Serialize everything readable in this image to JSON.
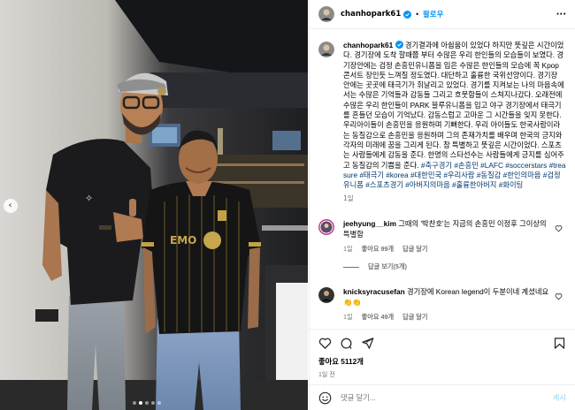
{
  "post": {
    "author": {
      "username": "chanhopark61",
      "avatar_icon": "avatar-photo",
      "verified_icon": "verified-badge-icon"
    },
    "follow_label": "팔로우",
    "separator": "•",
    "more_icon": "more-horizontal-icon",
    "more_label": "···",
    "caption": {
      "username": "chanhopark61",
      "text": "경기결과에 아쉼움이 있었다 하지만 뜻깊은 시간이었다. 경기장에 도착 할때쯤 부터 수많은 우리 한인들의 모습들이 보였다. 경기장안에는 검정 손흥민유니폼을 입은 수많은 한인들의 모습에 꼭 Kpop 콘서트 장인듯 느껴질 정도였다. 대단하고 훌륭한 국위선양이다. 경기장 안에는 곳곳에 태극기가 휘날리고 있었다. 경기를 지켜보는 나의 마음속에서는 수많은 기억들과 감동들 그리고 흐뭇함들이 스쳐지나갔다. 오래전에 수많은 우리 한인들이 PARK 블루유니폼을 입고 야구 경기장에서 태극기를 흔들던 모습이 기억났다. 감동스럽고 고마운 그 시간들을 잊지 못한다. 우리아이들이 손흥민을 응원하며 기뻐한다. 우리 아이들도 한국사람이라는 동질감으로 손흥민을 응원하며 그의 존재가치를 배우며 한국의 긍지와 각자의 미래에 꿈을 그리게 된다. 참 특별하고 뜻깊은 시간이었다. 스포츠는 사람들에게 감동을 준다. 한명의 스타선수는 사람들에게 긍지를 심어주고 동질감의 기쁨을 준다.",
      "hashtags": "#축구경기 #손흥민 #LAFC #soccerstars #treasure #태극기 #korea #대한민국 #우리사람 #동질감 #한인의마음 #검정유니폼 #스포츠경기 #아버지의마음 #훌륭한아버지 #화이팅",
      "time": "1일"
    },
    "comments": [
      {
        "username": "jeehyung__kim",
        "text": "그때의 '박찬호'는 지금의 손흥민 이정후 그이상의 특별함",
        "time": "1일",
        "likes": "좋아요 99개",
        "reply_label": "답글 달기",
        "heart_icon": "heart-outline-icon",
        "replies_label": "답글 보기(5개)"
      },
      {
        "username": "knicksyracusefan",
        "text": "경기장에 Korean legend이 두분이네 계셨네요 👏👏",
        "time": "1일",
        "likes": "좋아요 49개",
        "reply_label": "답글 달기",
        "heart_icon": "heart-outline-icon"
      }
    ],
    "actions": {
      "like_icon": "heart-icon",
      "comment_icon": "comment-icon",
      "share_icon": "send-icon",
      "save_icon": "bookmark-icon"
    },
    "likes_count": "좋아요 5112개",
    "date": "1일 전",
    "comment_input": {
      "emoji_icon": "emoji-icon",
      "placeholder": "댓글 달기...",
      "value": ""
    },
    "post_button": "게시"
  },
  "photo": {
    "prev_icon": "chevron-left-icon",
    "prev_glyph": "‹",
    "dots": 5,
    "active_dot": 1,
    "jersey_text": "EMO"
  }
}
